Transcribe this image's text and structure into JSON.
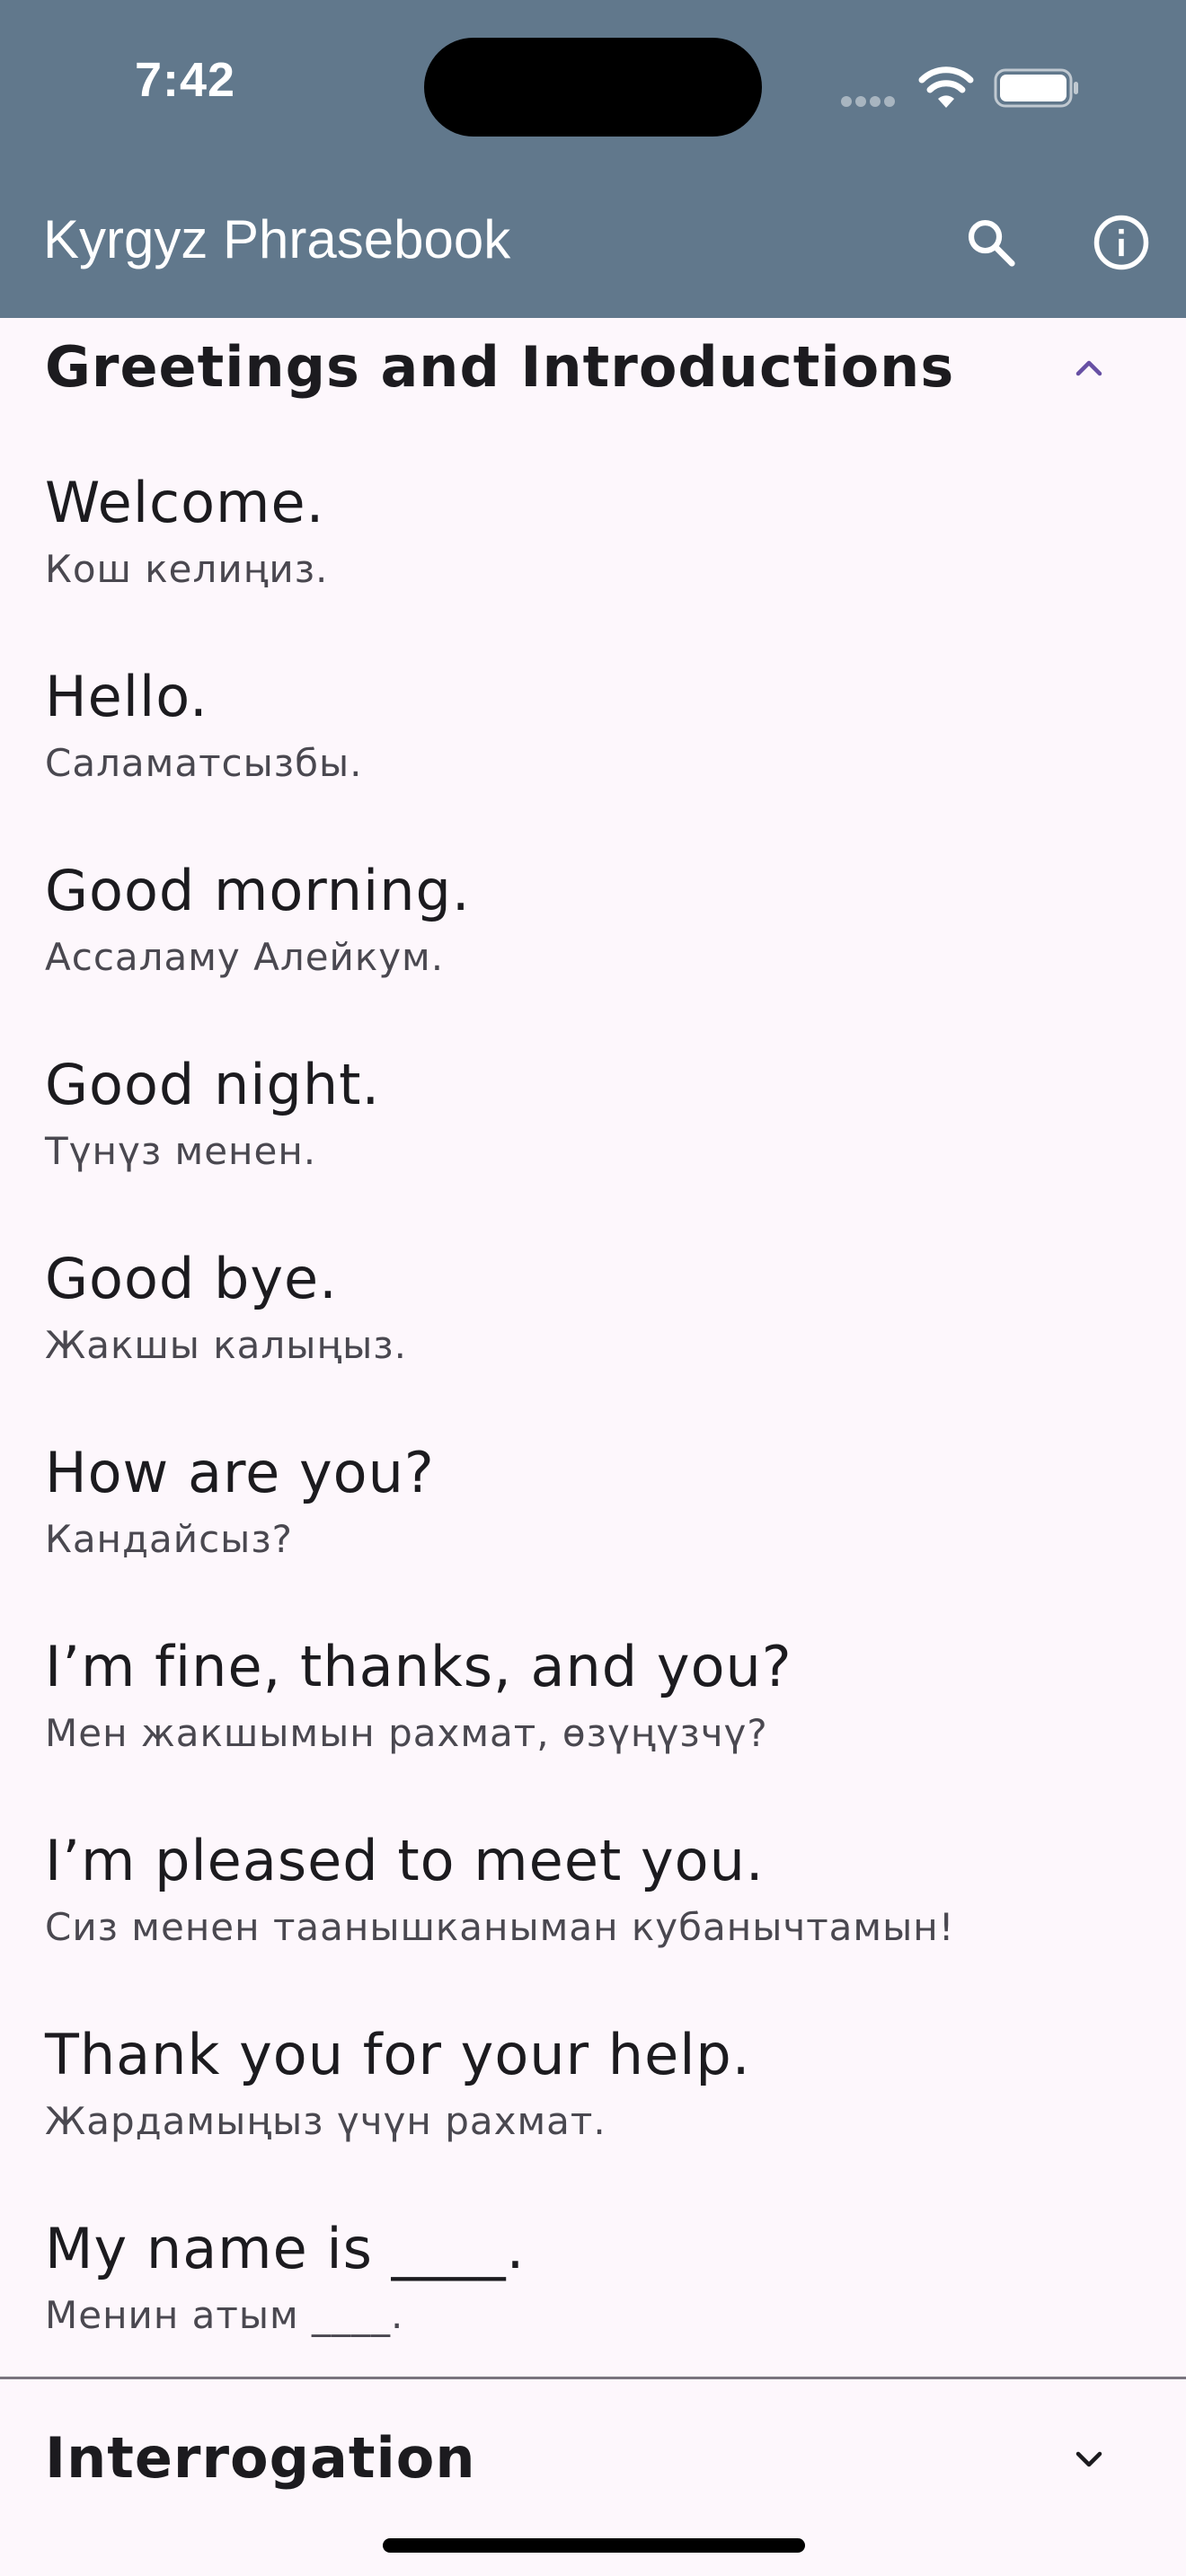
{
  "status_bar": {
    "time": "7:42"
  },
  "app_bar": {
    "title": "Kyrgyz Phrasebook",
    "actions": [
      {
        "icon": "search-icon",
        "label": "Search"
      },
      {
        "icon": "info-icon",
        "label": "Info"
      }
    ],
    "background_color": "#61788c"
  },
  "sections": [
    {
      "title": "Greetings and Introductions",
      "expanded": true,
      "chevron_color": "#6750a4",
      "phrases": [
        {
          "en": "Welcome.",
          "ky": "Кош келиңиз."
        },
        {
          "en": "Hello.",
          "ky": "Саламатсызбы."
        },
        {
          "en": "Good morning.",
          "ky": "Ассаламу Алейкум."
        },
        {
          "en": "Good night.",
          "ky": "Түнүз менен."
        },
        {
          "en": "Good bye.",
          "ky": "Жакшы калыңыз."
        },
        {
          "en": "How are you?",
          "ky": "Кандайсыз?"
        },
        {
          "en": "I’m fine, thanks, and you?",
          "ky": "Мен жакшымын рахмат, өзүңүзчү?"
        },
        {
          "en": "I’m pleased to meet you.",
          "ky": "Сиз менен таанышканыман кубанычтамын!"
        },
        {
          "en": "Thank you for your help.",
          "ky": "Жардамыңыз үчүн рахмат."
        },
        {
          "en": "My name is ____.",
          "ky": "Менин атым ____."
        }
      ]
    },
    {
      "title": "Interrogation",
      "expanded": false,
      "chevron_color": "#1c1b1f"
    }
  ]
}
